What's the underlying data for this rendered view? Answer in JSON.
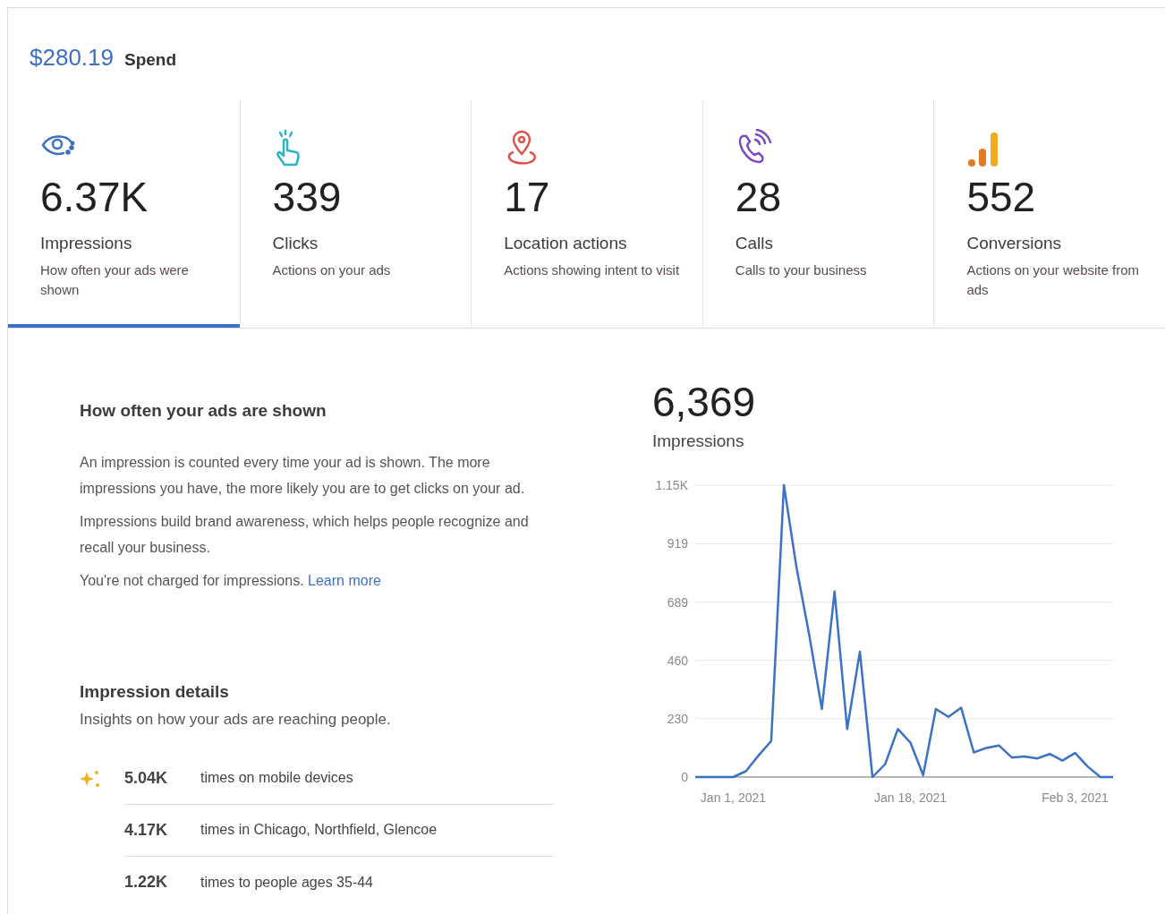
{
  "spend": {
    "amount": "$280.19",
    "label": "Spend"
  },
  "metrics": [
    {
      "kind": "eye",
      "value": "6.37K",
      "label": "Impressions",
      "description": "How often your ads were shown",
      "selected": true
    },
    {
      "kind": "tap",
      "value": "339",
      "label": "Clicks",
      "description": "Actions on your ads",
      "selected": false
    },
    {
      "kind": "pin",
      "value": "17",
      "label": "Location actions",
      "description": "Actions showing intent to visit",
      "selected": false
    },
    {
      "kind": "phone",
      "value": "28",
      "label": "Calls",
      "description": "Calls to your business",
      "selected": false
    },
    {
      "kind": "bars",
      "value": "552",
      "label": "Conversions",
      "description": "Actions on your website from ads",
      "selected": false
    }
  ],
  "explanation": {
    "title": "How often your ads are shown",
    "paragraphs": [
      "An impression is counted every time your ad is shown. The more impressions you have, the more likely you are to get clicks on your ad.",
      "Impressions build brand awareness, which helps people recognize and recall your business.",
      "You're not charged for impressions."
    ],
    "link": "Learn more"
  },
  "details": {
    "title": "Impression details",
    "subtitle": "Insights on how your ads are reaching people.",
    "rows": [
      {
        "value": "5.04K",
        "text": "times on mobile devices",
        "highlighted": true
      },
      {
        "value": "4.17K",
        "text": "times in Chicago, Northfield, Glencoe",
        "highlighted": false
      },
      {
        "value": "1.22K",
        "text": "times to people ages 35-44",
        "highlighted": false
      }
    ]
  },
  "summary": {
    "value": "6,369",
    "label": "Impressions"
  },
  "chart_data": {
    "type": "line",
    "grid": true,
    "categories": [
      null,
      null,
      null,
      "Jan 1, 2021",
      null,
      null,
      null,
      null,
      null,
      null,
      null,
      null,
      null,
      null,
      null,
      null,
      null,
      "Jan 18, 2021",
      null,
      null,
      null,
      null,
      null,
      null,
      null,
      null,
      null,
      null,
      null,
      null,
      "Feb 3, 2021",
      null,
      null,
      null
    ],
    "series": [
      {
        "color": "#3b73c4",
        "values": [
          0,
          0,
          0,
          0,
          23,
          85,
          142,
          1150,
          825,
          560,
          268,
          731,
          189,
          494,
          0,
          51,
          189,
          135,
          7,
          268,
          237,
          273,
          97,
          115,
          124,
          77,
          81,
          73,
          91,
          65,
          95,
          41,
          0,
          0
        ]
      }
    ],
    "ylim": [
      0,
      1150
    ],
    "yticks": [
      0,
      230,
      460,
      689,
      919,
      {
        "value": 1150,
        "label": "1.15K"
      }
    ]
  }
}
